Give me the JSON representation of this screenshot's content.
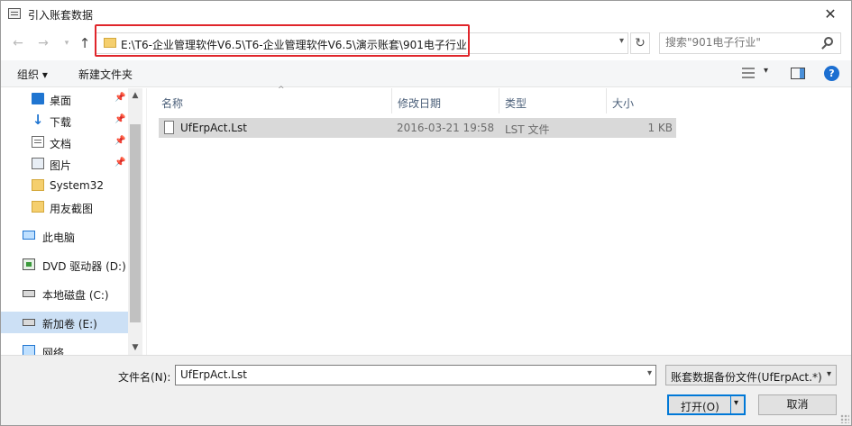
{
  "window": {
    "title": "引入账套数据",
    "close_glyph": "✕"
  },
  "navigation": {
    "back_glyph": "←",
    "forward_glyph": "→",
    "recent_glyph": "▾",
    "up_glyph": "↑",
    "refresh_glyph": "↻",
    "address_path": "E:\\T6-企业管理软件V6.5\\T6-企业管理软件V6.5\\演示账套\\901电子行业",
    "dropdown_glyph": "▾",
    "search_placeholder": "搜索\"901电子行业\""
  },
  "toolbar": {
    "organize_label": "组织 ▾",
    "new_folder_label": "新建文件夹",
    "view_arrow": "▾",
    "help_label": "?"
  },
  "sidebar": {
    "pin_glyph": "📌",
    "items": [
      {
        "label": "桌面",
        "icon": "desktop-icon",
        "pinned": true
      },
      {
        "label": "下载",
        "icon": "download-icon",
        "pinned": true
      },
      {
        "label": "文档",
        "icon": "document-icon",
        "pinned": true
      },
      {
        "label": "图片",
        "icon": "pictures-icon",
        "pinned": true
      },
      {
        "label": "System32",
        "icon": "folder-icon",
        "pinned": false
      },
      {
        "label": "用友截图",
        "icon": "folder-icon",
        "pinned": false
      },
      {
        "label": "此电脑",
        "icon": "computer-icon",
        "pinned": false
      },
      {
        "label": "DVD 驱动器 (D:)",
        "icon": "dvd-drive-icon",
        "pinned": false
      },
      {
        "label": "本地磁盘 (C:)",
        "icon": "disk-icon",
        "pinned": false
      },
      {
        "label": "新加卷 (E:)",
        "icon": "disk-icon",
        "pinned": false,
        "selected": true
      },
      {
        "label": "网络",
        "icon": "network-icon",
        "pinned": false
      }
    ],
    "scroll_up_glyph": "▲",
    "scroll_down_glyph": "▼"
  },
  "file_list": {
    "columns": {
      "name": "名称",
      "date": "修改日期",
      "type": "类型",
      "size": "大小"
    },
    "sort_glyph": "^",
    "rows": [
      {
        "name": "UfErpAct.Lst",
        "date": "2016-03-21 19:58",
        "type": "LST 文件",
        "size": "1 KB"
      }
    ]
  },
  "footer": {
    "filename_label": "文件名(N):",
    "filename_value": "UfErpAct.Lst",
    "dropdown_glyph": "▾",
    "filetype_value": "账套数据备份文件(UfErpAct.*)",
    "open_label": "打开(O)",
    "open_arrow": "▾",
    "cancel_label": "取消"
  },
  "colors": {
    "address_highlight": "#e0262b",
    "selection": "#cce0f5",
    "accent": "#0078d7"
  }
}
